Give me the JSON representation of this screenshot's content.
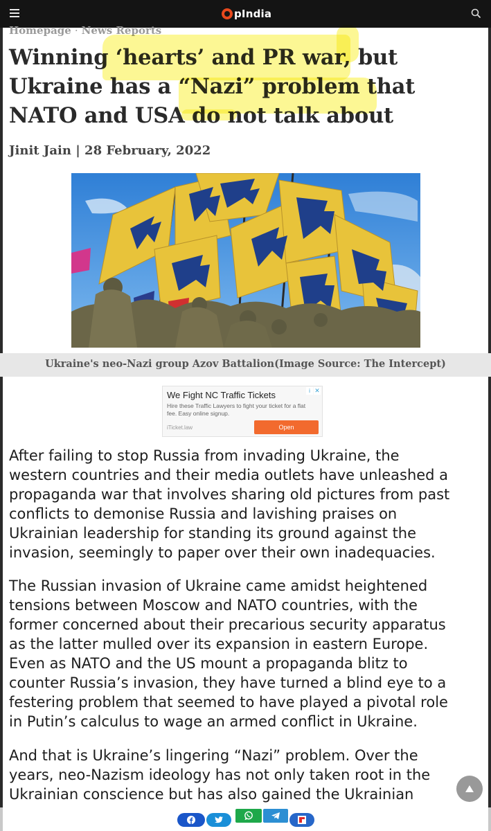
{
  "header": {
    "logo_text": "pIndia",
    "menu_icon": "hamburger-menu-icon",
    "search_icon": "search-icon",
    "logo_accent": "#e8491d",
    "bar_color": "#141414"
  },
  "breadcrumb": {
    "home": "Homepage",
    "separator": "·",
    "section": "News Reports"
  },
  "article": {
    "headline_lines": [
      "Winning ‘hearts’ and PR war, but",
      "Ukraine has a “Nazi” problem that",
      "NATO and USA do not talk about"
    ],
    "byline": "Jinit Jain | 28 February, 2022",
    "image_caption": "Ukraine's neo-Nazi group Azov Battalion(Image Source: The Intercept)",
    "paragraphs": [
      [
        "After failing to stop Russia from invading Ukraine, the",
        "western countries and their media outlets have unleashed a",
        "propaganda war that involves sharing old pictures from past",
        "conflicts to demonise Russia and lavishing praises on",
        "Ukrainian leadership for standing its ground against the",
        "invasion, seemingly to paper over their own inadequacies."
      ],
      [
        "The Russian invasion of Ukraine came amidst heightened",
        "tensions between Moscow and NATO countries, with the",
        "former concerned about their precarious security apparatus",
        "as the latter mulled over its expansion in eastern Europe.",
        "Even as NATO and the US mount a propaganda blitz to",
        "counter Russia’s invasion, they have turned a blind eye to a",
        "festering problem that seemed to have played a pivotal role",
        "in Putin’s calculus to wage an armed conflict in Ukraine."
      ],
      [
        "And that is Ukraine’s lingering “Nazi” problem. Over the",
        "years, neo-Nazism ideology has not only taken root in the",
        "Ukrainian conscience but has also gained the Ukrainian"
      ]
    ],
    "highlight_color": "#faf03c"
  },
  "ad": {
    "title": "We Fight NC Traffic Tickets",
    "text": "Hire these Traffic Lawyers to fight your ticket for a flat fee. Easy online signup.",
    "domain": "iTicket.law",
    "button": "Open",
    "choices_info": "i",
    "choices_close": "✕",
    "button_color": "#f26a2e"
  },
  "share": {
    "icons": [
      "facebook-icon",
      "twitter-icon",
      "whatsapp-icon",
      "telegram-icon",
      "flipboard-icon"
    ]
  },
  "scroll_top": {
    "icon": "arrow-up-icon"
  }
}
